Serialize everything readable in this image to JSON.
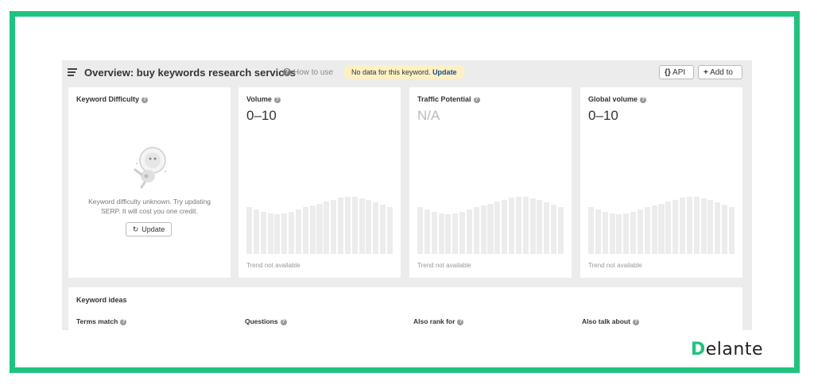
{
  "header": {
    "title": "Overview: buy keywords research services",
    "how_to_use": "How to use",
    "notice_text": "No data for this keyword.",
    "notice_link": "Update",
    "api_label": "API",
    "add_to_label": "Add to"
  },
  "cards": {
    "keyword_difficulty": {
      "title": "Keyword Difficulty",
      "message": "Keyword difficulty unknown. Try updating SERP. It will cost you one credit.",
      "update_label": "Update"
    },
    "volume": {
      "title": "Volume",
      "value": "0–10",
      "trend_note": "Trend not available"
    },
    "traffic_potential": {
      "title": "Traffic Potential",
      "value": "N/A",
      "trend_note": "Trend not available"
    },
    "global_volume": {
      "title": "Global volume",
      "value": "0–10",
      "trend_note": "Trend not available"
    }
  },
  "placeholder_trend_levels": [
    0.82,
    0.78,
    0.74,
    0.71,
    0.69,
    0.71,
    0.74,
    0.78,
    0.82,
    0.85,
    0.88,
    0.92,
    0.95,
    0.98,
    1.0,
    1.0,
    0.97,
    0.94,
    0.9,
    0.86,
    0.82
  ],
  "keyword_ideas": {
    "title": "Keyword ideas",
    "columns": [
      "Terms match",
      "Questions",
      "Also rank for",
      "Also talk about"
    ]
  },
  "brand": {
    "logo_text": "elante",
    "logo_initial": "D"
  },
  "colors": {
    "frame_green": "#1fc37f",
    "notice_bg": "#fdf0c4",
    "link_blue": "#1b4e8a"
  }
}
